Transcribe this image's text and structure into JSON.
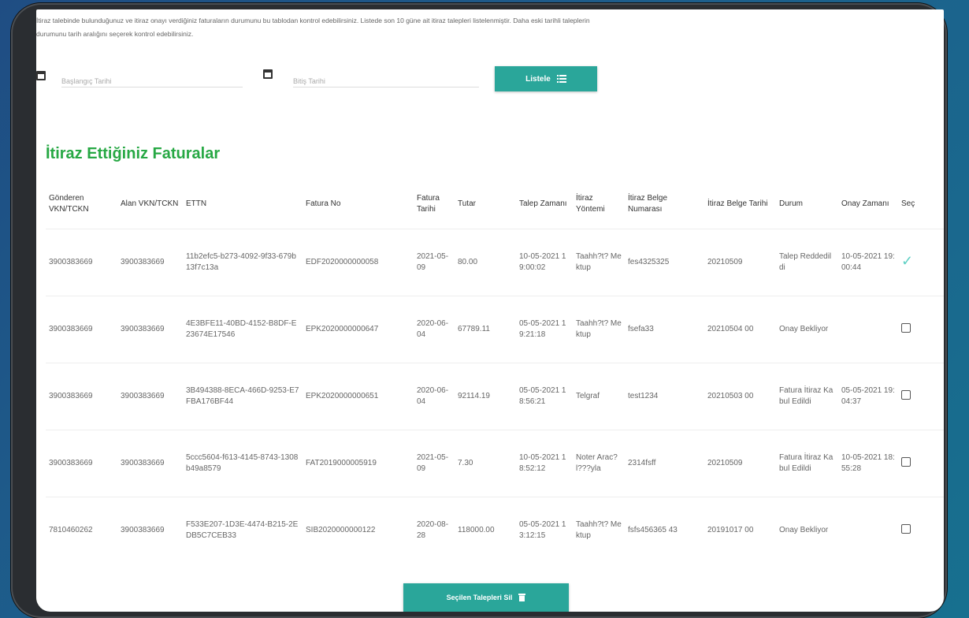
{
  "intro": {
    "line1": "İtiraz talebinde bulunduğunuz ve itiraz onayı verdiğiniz faturaların durumunu bu tablodan kontrol edebilirsiniz. Listede son 10 güne ait itiraz talepleri listelenmiştir. Daha eski tarihli taleplerin",
    "line2": "durumunu tarih aralığını seçerek kontrol edebilirsiniz."
  },
  "filters": {
    "start_placeholder": "Başlangıç Tarihi",
    "end_placeholder": "Bitiş Tarihi",
    "list_button": "Listele",
    "list_icon": "list-icon"
  },
  "section_title": "İtiraz Ettiğiniz Faturalar",
  "table": {
    "headers": [
      "Gönderen VKN/TCKN",
      "Alan VKN/TCKN",
      "ETTN",
      "Fatura No",
      "Fatura Tarihi",
      "Tutar",
      "Talep Zamanı",
      "İtiraz Yöntemi",
      "İtiraz Belge Numarası",
      "İtiraz Belge Tarihi",
      "Durum",
      "Onay Zamanı",
      "Seç"
    ],
    "rows": [
      [
        "3900383669",
        "3900383669",
        "11b2efc5-b273-4092-9f33-679b13f7c13a",
        "EDF2020000000058",
        "2021-05-09",
        "80.00",
        "10-05-2021 19:00:02",
        "Taahh?t? Mektup",
        "fes4325325",
        "20210509",
        "Talep Reddedildi",
        "10-05-2021 19:00:44",
        "checked"
      ],
      [
        "3900383669",
        "3900383669",
        "4E3BFE11-40BD-4152-B8DF-E23674E17546",
        "EPK2020000000647",
        "2020-06-04",
        "67789.11",
        "05-05-2021 19:21:18",
        "Taahh?t? Mektup",
        "fsefa33",
        "20210504 00",
        "Onay Bekliyor",
        "",
        "unchecked"
      ],
      [
        "3900383669",
        "3900383669",
        "3B494388-8ECA-466D-9253-E7FBA176BF44",
        "EPK2020000000651",
        "2020-06-04",
        "92114.19",
        "05-05-2021 18:56:21",
        "Telgraf",
        "test1234",
        "20210503 00",
        "Fatura İtiraz Kabul Edildi",
        "05-05-2021 19:04:37",
        "unchecked"
      ],
      [
        "3900383669",
        "3900383669",
        "5ccc5604-f613-4145-8743-1308b49a8579",
        "FAT2019000005919",
        "2021-05-09",
        "7.30",
        "10-05-2021 18:52:12",
        "Noter Arac?l???yla",
        "2314fsff",
        "20210509",
        "Fatura İtiraz Kabul Edildi",
        "10-05-2021 18:55:28",
        "unchecked"
      ],
      [
        "7810460262",
        "3900383669",
        "F533E207-1D3E-4474-B215-2EDB5C7CEB33",
        "SIB2020000000122",
        "2020-08-28",
        "118000.00",
        "05-05-2021 13:12:15",
        "Taahh?t? Mektup",
        "fsfs456365 43",
        "20191017 00",
        "Onay Bekliyor",
        "",
        "unchecked"
      ]
    ]
  },
  "delete_button": "Seçilen Talepleri Sil",
  "delete_icon": "trash-icon",
  "colors": {
    "accent": "#2aa69a",
    "title": "#27a844"
  }
}
